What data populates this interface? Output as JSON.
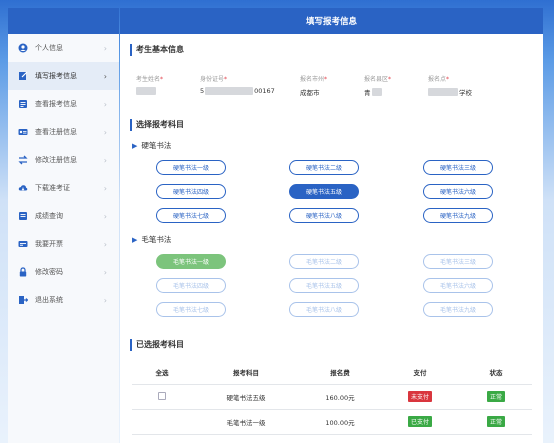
{
  "header": {
    "title": "填写报考信息"
  },
  "sidebar": {
    "items": [
      {
        "label": "个人信息",
        "icon": "user-icon"
      },
      {
        "label": "填写报考信息",
        "icon": "edit-icon"
      },
      {
        "label": "查看报考信息",
        "icon": "document-icon"
      },
      {
        "label": "查看注册信息",
        "icon": "id-card-icon"
      },
      {
        "label": "修改注册信息",
        "icon": "swap-icon"
      },
      {
        "label": "下载准考证",
        "icon": "cloud-download-icon"
      },
      {
        "label": "成绩查询",
        "icon": "score-icon"
      },
      {
        "label": "我要开票",
        "icon": "invoice-icon"
      },
      {
        "label": "修改密码",
        "icon": "lock-icon"
      },
      {
        "label": "退出系统",
        "icon": "logout-icon"
      }
    ],
    "chevron": "›"
  },
  "basic_info": {
    "title": "考生基本信息",
    "fields": [
      {
        "label": "考生姓名",
        "req": "*",
        "value": ""
      },
      {
        "label": "身份证号",
        "req": "*",
        "value_prefix": "5",
        "value_suffix": "00167"
      },
      {
        "label": "报名市州",
        "req": "*",
        "value": "成都市"
      },
      {
        "label": "报名县区",
        "req": "*",
        "value_prefix": "青"
      },
      {
        "label": "报名点",
        "req": "*",
        "value_suffix": "学校"
      }
    ]
  },
  "subjects": {
    "title": "选择报考科目",
    "groups": [
      {
        "name": "硬笔书法",
        "items": [
          "硬笔书法一级",
          "硬笔书法二级",
          "硬笔书法三级",
          "硬笔书法四级",
          "硬笔书法五级",
          "硬笔书法六级",
          "硬笔书法七级",
          "硬笔书法八级",
          "硬笔书法九级"
        ]
      },
      {
        "name": "毛笔书法",
        "items": [
          "毛笔书法一级",
          "毛笔书法二级",
          "毛笔书法三级",
          "毛笔书法四级",
          "毛笔书法五级",
          "毛笔书法六级",
          "毛笔书法七级",
          "毛笔书法八级",
          "毛笔书法九级"
        ]
      }
    ]
  },
  "selected": {
    "title": "已选报考科目",
    "columns": [
      "全选",
      "报考科目",
      "报名费",
      "支付",
      "状态"
    ],
    "rows": [
      {
        "subject": "硬笔书法五级",
        "fee": "160.00元",
        "pay": "未支付",
        "status": "正常"
      },
      {
        "subject": "毛笔书法一级",
        "fee": "100.00元",
        "pay": "已支付",
        "status": "正常"
      }
    ]
  },
  "colors": {
    "primary": "#2a63c4",
    "unpaid": "#d9363e",
    "paid": "#3aa945"
  }
}
